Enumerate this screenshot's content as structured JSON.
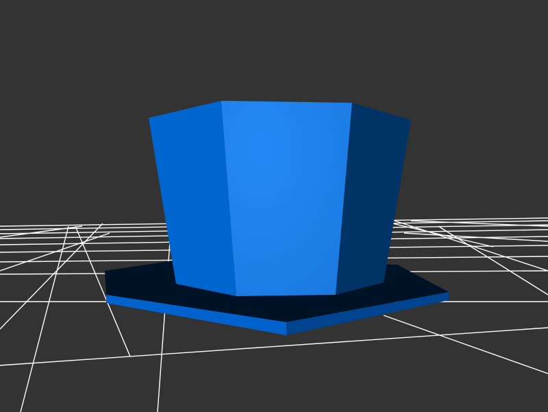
{
  "viewport": {
    "background_color": "#333333",
    "grid_color": "#ffffff"
  },
  "model": {
    "shape": "hexagonal-prism-on-hexagonal-base",
    "colors": {
      "base_top": "#001326",
      "base_front": "#0062cc",
      "base_right": "#00438f",
      "body_left": "#0066cf",
      "body_front_light": "#2489f5",
      "body_front_dark": "#1a78e0",
      "body_right": "#003366",
      "body_top": "#1a7cea"
    }
  }
}
